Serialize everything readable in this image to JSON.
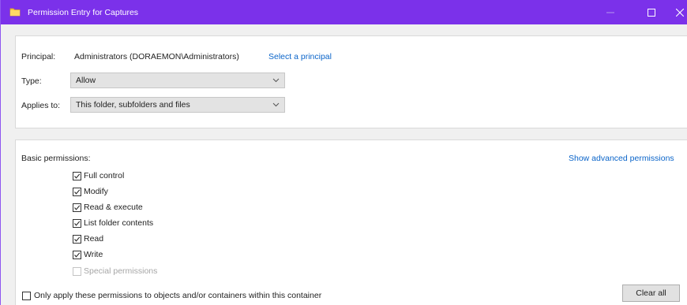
{
  "window": {
    "title": "Permission Entry for Captures"
  },
  "principal": {
    "label": "Principal:",
    "value": "Administrators (DORAEMON\\Administrators)",
    "select_link": "Select a principal"
  },
  "type": {
    "label": "Type:",
    "selected": "Allow"
  },
  "applies_to": {
    "label": "Applies to:",
    "selected": "This folder, subfolders and files"
  },
  "basic_permissions": {
    "heading": "Basic permissions:",
    "advanced_link": "Show advanced permissions",
    "items": [
      {
        "label": "Full control",
        "checked": true,
        "disabled": false
      },
      {
        "label": "Modify",
        "checked": true,
        "disabled": false
      },
      {
        "label": "Read & execute",
        "checked": true,
        "disabled": false
      },
      {
        "label": "List folder contents",
        "checked": true,
        "disabled": false
      },
      {
        "label": "Read",
        "checked": true,
        "disabled": false
      },
      {
        "label": "Write",
        "checked": true,
        "disabled": false
      },
      {
        "label": "Special permissions",
        "checked": false,
        "disabled": true
      }
    ]
  },
  "only_apply": {
    "label": "Only apply these permissions to objects and/or containers within this container",
    "checked": false
  },
  "buttons": {
    "clear_all": "Clear all"
  },
  "colors": {
    "titlebar": "#7b31ea",
    "link": "#0a64c9"
  },
  "icons": {
    "title_icon": "folder-icon",
    "minimize": "minimize-icon",
    "maximize": "maximize-icon",
    "close": "close-icon"
  }
}
